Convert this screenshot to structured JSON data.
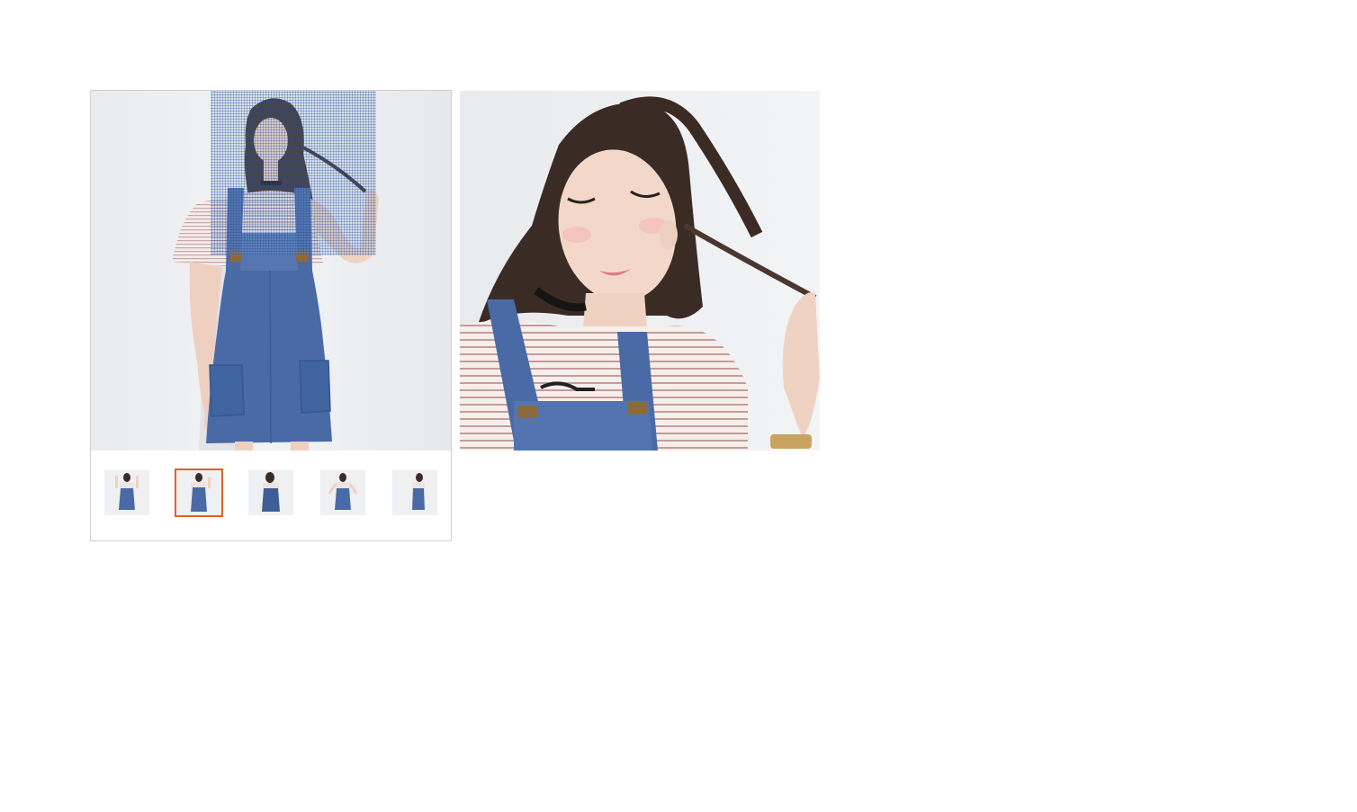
{
  "gallery": {
    "main_image": {
      "subject": "model-in-denim-overall-dress",
      "icon": "product-photo"
    },
    "lens": {
      "icon": "magnifier-lens"
    },
    "zoom_preview": {
      "icon": "zoomed-product-photo"
    },
    "thumbnails": [
      {
        "icon": "thumbnail-photo",
        "selected": false
      },
      {
        "icon": "thumbnail-photo",
        "selected": true
      },
      {
        "icon": "thumbnail-photo",
        "selected": false
      },
      {
        "icon": "thumbnail-photo",
        "selected": false
      },
      {
        "icon": "thumbnail-photo",
        "selected": false
      }
    ],
    "colors": {
      "selected_border": "#e4621b",
      "frame_border": "#cfcfcf",
      "denim": "#4a6aa6"
    }
  }
}
